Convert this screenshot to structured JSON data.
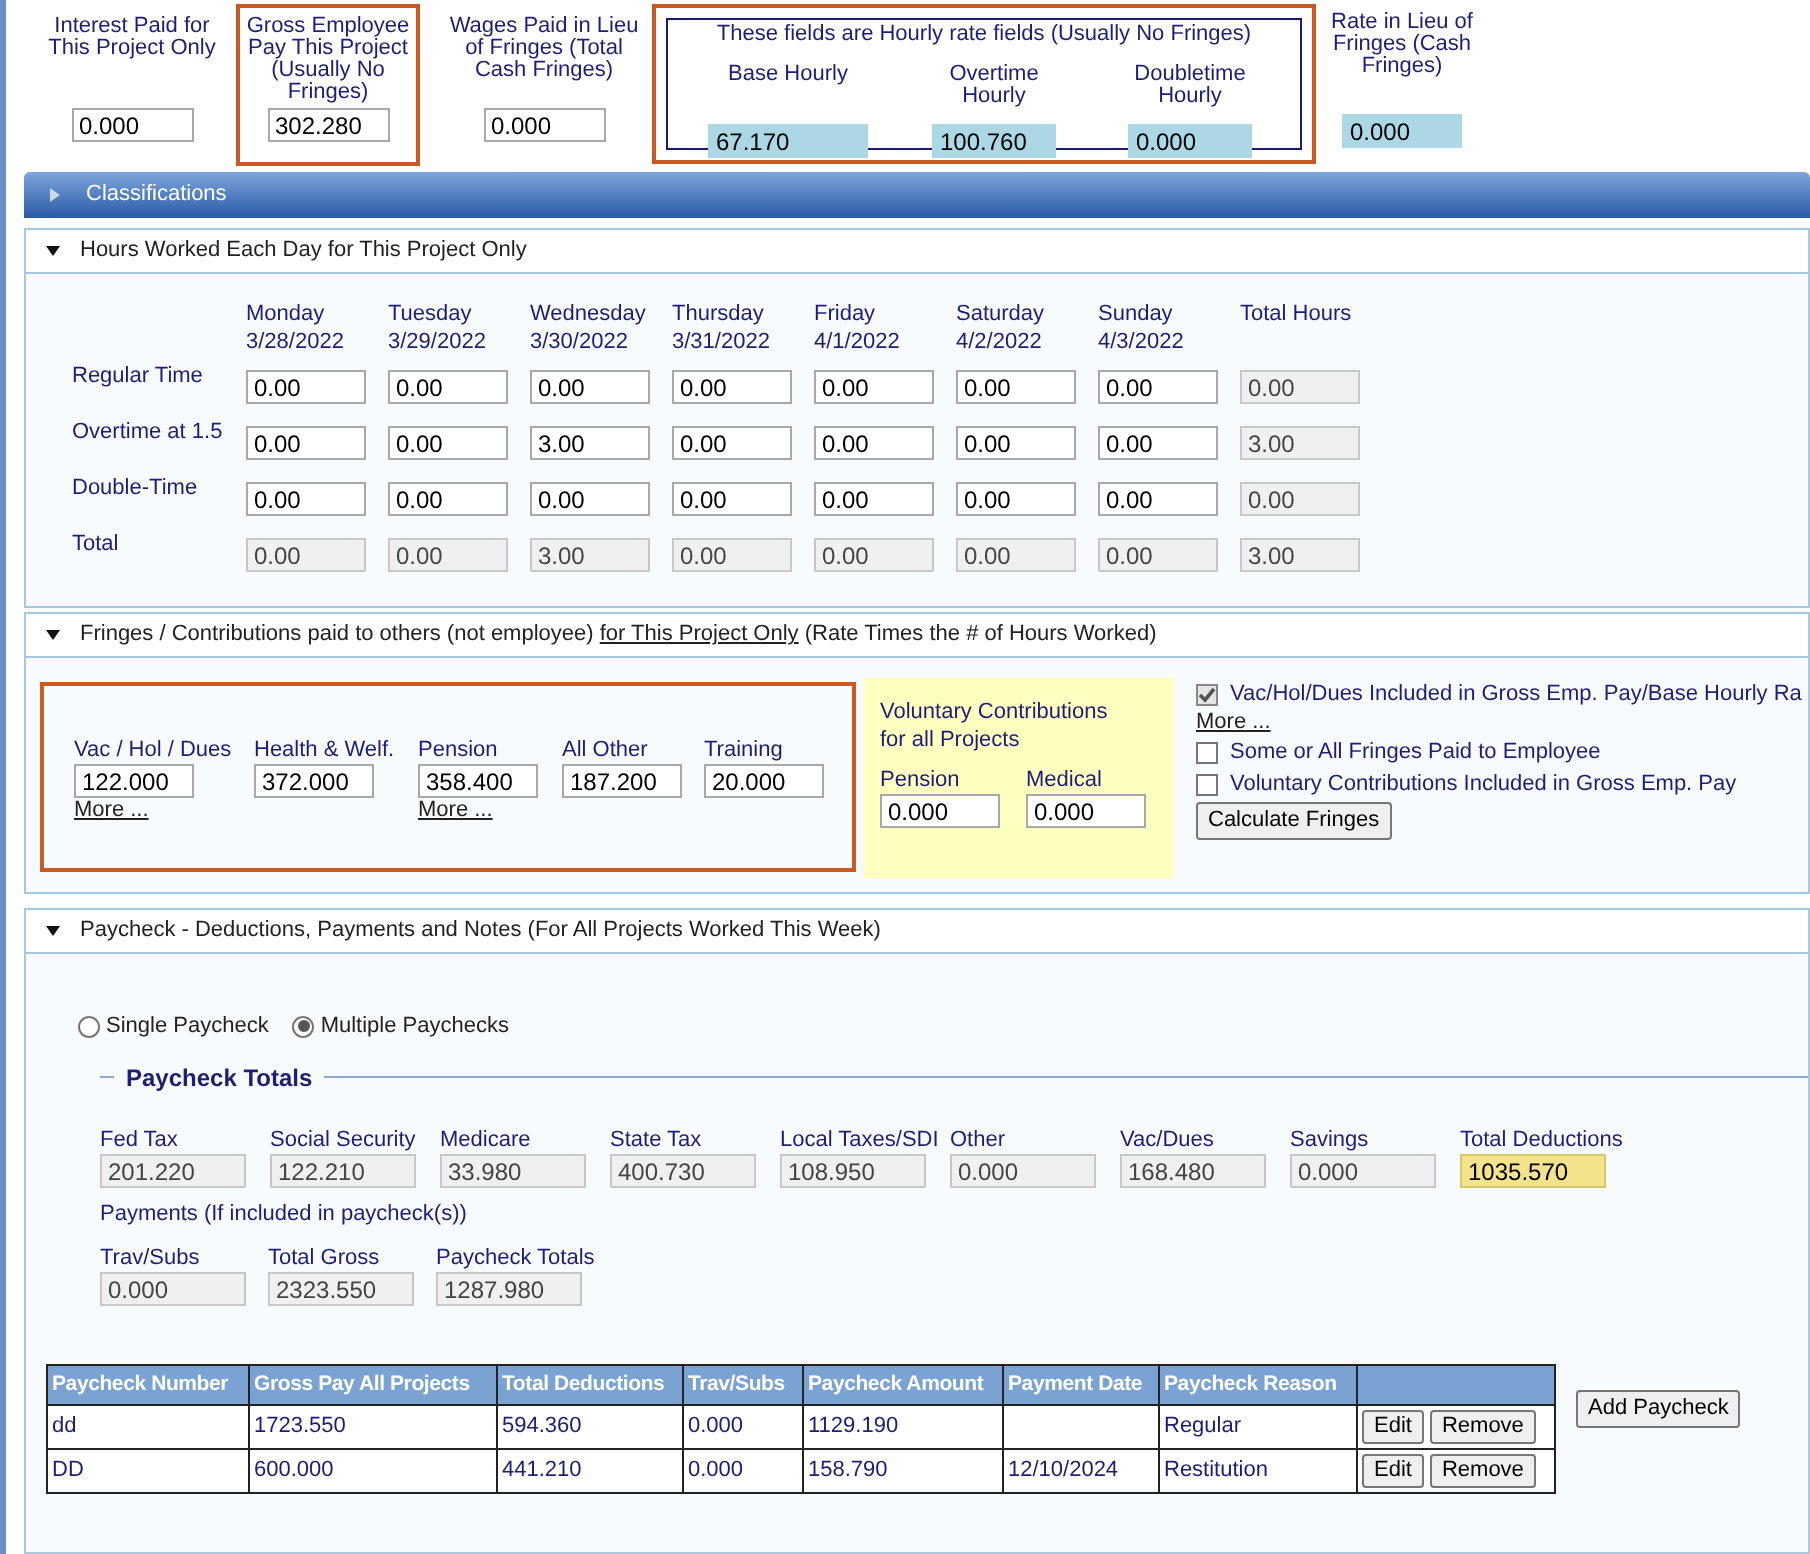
{
  "top": {
    "fields": [
      {
        "label": "Interest Paid for This Project Only",
        "value": "0.000",
        "highlighted": false
      },
      {
        "label": "Gross Employee Pay This Project (Usually No Fringes)",
        "value": "302.280",
        "highlighted": true
      },
      {
        "label": "Wages Paid in Lieu of Fringes (Total Cash Fringes)",
        "value": "0.000",
        "highlighted": false
      }
    ],
    "hourly_group": {
      "caption": "These fields are Hourly rate fields (Usually No Fringes)",
      "highlighted": true,
      "fields": [
        {
          "label": "Base Hourly",
          "value": "67.170"
        },
        {
          "label": "Overtime Hourly",
          "value": "100.760"
        },
        {
          "label": "Doubletime Hourly",
          "value": "0.000"
        }
      ]
    },
    "rate_in_lieu": {
      "label": "Rate in Lieu of Fringes (Cash Fringes)",
      "value": "0.000"
    }
  },
  "classifications": {
    "title": "Classifications",
    "expanded": false
  },
  "hours": {
    "title": "Hours Worked Each Day for This Project Only",
    "expanded": true,
    "days": [
      {
        "day": "Monday",
        "date": "3/28/2022"
      },
      {
        "day": "Tuesday",
        "date": "3/29/2022"
      },
      {
        "day": "Wednesday",
        "date": "3/30/2022"
      },
      {
        "day": "Thursday",
        "date": "3/31/2022"
      },
      {
        "day": "Friday",
        "date": "4/1/2022"
      },
      {
        "day": "Saturday",
        "date": "4/2/2022"
      },
      {
        "day": "Sunday",
        "date": "4/3/2022"
      }
    ],
    "total_header": "Total Hours",
    "rows": [
      {
        "label": "Regular Time",
        "readonly": false,
        "cells": [
          "0.00",
          "0.00",
          "0.00",
          "0.00",
          "0.00",
          "0.00",
          "0.00"
        ],
        "total": "0.00"
      },
      {
        "label": "Overtime at 1.5",
        "readonly": false,
        "cells": [
          "0.00",
          "0.00",
          "3.00",
          "0.00",
          "0.00",
          "0.00",
          "0.00"
        ],
        "total": "3.00"
      },
      {
        "label": "Double-Time",
        "readonly": false,
        "cells": [
          "0.00",
          "0.00",
          "0.00",
          "0.00",
          "0.00",
          "0.00",
          "0.00"
        ],
        "total": "0.00"
      },
      {
        "label": "Total",
        "readonly": true,
        "cells": [
          "0.00",
          "0.00",
          "3.00",
          "0.00",
          "0.00",
          "0.00",
          "0.00"
        ],
        "total": "3.00"
      }
    ]
  },
  "fringes": {
    "title_before": "Fringes / Contributions paid to others (not employee)",
    "title_link": "for This Project Only",
    "title_after": "(Rate Times the # of Hours Worked)",
    "expanded": true,
    "highlighted": true,
    "fields": [
      {
        "label": "Vac / Hol / Dues",
        "value": "122.000",
        "more": "More ..."
      },
      {
        "label": "Health & Welf.",
        "value": "372.000"
      },
      {
        "label": "Pension",
        "value": "358.400",
        "more": "More ..."
      },
      {
        "label": "All Other",
        "value": "187.200"
      },
      {
        "label": "Training",
        "value": "20.000"
      }
    ],
    "voluntary": {
      "caption": "Voluntary Contributions for all Projects",
      "fields": [
        {
          "label": "Pension",
          "value": "0.000"
        },
        {
          "label": "Medical",
          "value": "0.000"
        }
      ]
    },
    "checkboxes": [
      {
        "label": "Vac/Hol/Dues Included in Gross Emp. Pay/Base Hourly Ra",
        "checked": true,
        "more": "More ..."
      },
      {
        "label": "Some or All Fringes Paid to Employee",
        "checked": false
      },
      {
        "label": "Voluntary Contributions Included in Gross Emp. Pay",
        "checked": false
      }
    ],
    "button": "Calculate Fringes"
  },
  "paycheck": {
    "title": "Paycheck - Deductions, Payments and Notes (For All Projects Worked This Week)",
    "expanded": true,
    "radios": [
      {
        "label": "Single Paycheck",
        "selected": false
      },
      {
        "label": "Multiple Paychecks",
        "selected": true
      }
    ],
    "totals_legend": "Paycheck Totals",
    "deductions": [
      {
        "label": "Fed Tax",
        "value": "201.220",
        "highlighted": false
      },
      {
        "label": "Social Security",
        "value": "122.210",
        "highlighted": false
      },
      {
        "label": "Medicare",
        "value": "33.980",
        "highlighted": false
      },
      {
        "label": "State Tax",
        "value": "400.730",
        "highlighted": false
      },
      {
        "label": "Local Taxes/SDI",
        "value": "108.950",
        "highlighted": false
      },
      {
        "label": "Other",
        "value": "0.000",
        "highlighted": false
      },
      {
        "label": "Vac/Dues",
        "value": "168.480",
        "highlighted": false
      },
      {
        "label": "Savings",
        "value": "0.000",
        "highlighted": false
      },
      {
        "label": "Total Deductions",
        "value": "1035.570",
        "highlighted": true
      }
    ],
    "payments_label": "Payments (If included in paycheck(s))",
    "payments": [
      {
        "label": "Trav/Subs",
        "value": "0.000"
      },
      {
        "label": "Total Gross",
        "value": "2323.550"
      },
      {
        "label": "Paycheck Totals",
        "value": "1287.980"
      }
    ],
    "table": {
      "columns": [
        "Paycheck Number",
        "Gross Pay All Projects",
        "Total Deductions",
        "Trav/Subs",
        "Paycheck Amount",
        "Payment Date",
        "Paycheck Reason"
      ],
      "rows": [
        {
          "cells": [
            "dd",
            "1723.550",
            "594.360",
            "0.000",
            "1129.190",
            "",
            "Regular"
          ],
          "buttons": [
            "Edit",
            "Remove"
          ]
        },
        {
          "cells": [
            "DD",
            "600.000",
            "441.210",
            "0.000",
            "158.790",
            "12/10/2024",
            "Restitution"
          ],
          "buttons": [
            "Edit",
            "Remove"
          ]
        }
      ]
    },
    "add_button": "Add Paycheck"
  }
}
